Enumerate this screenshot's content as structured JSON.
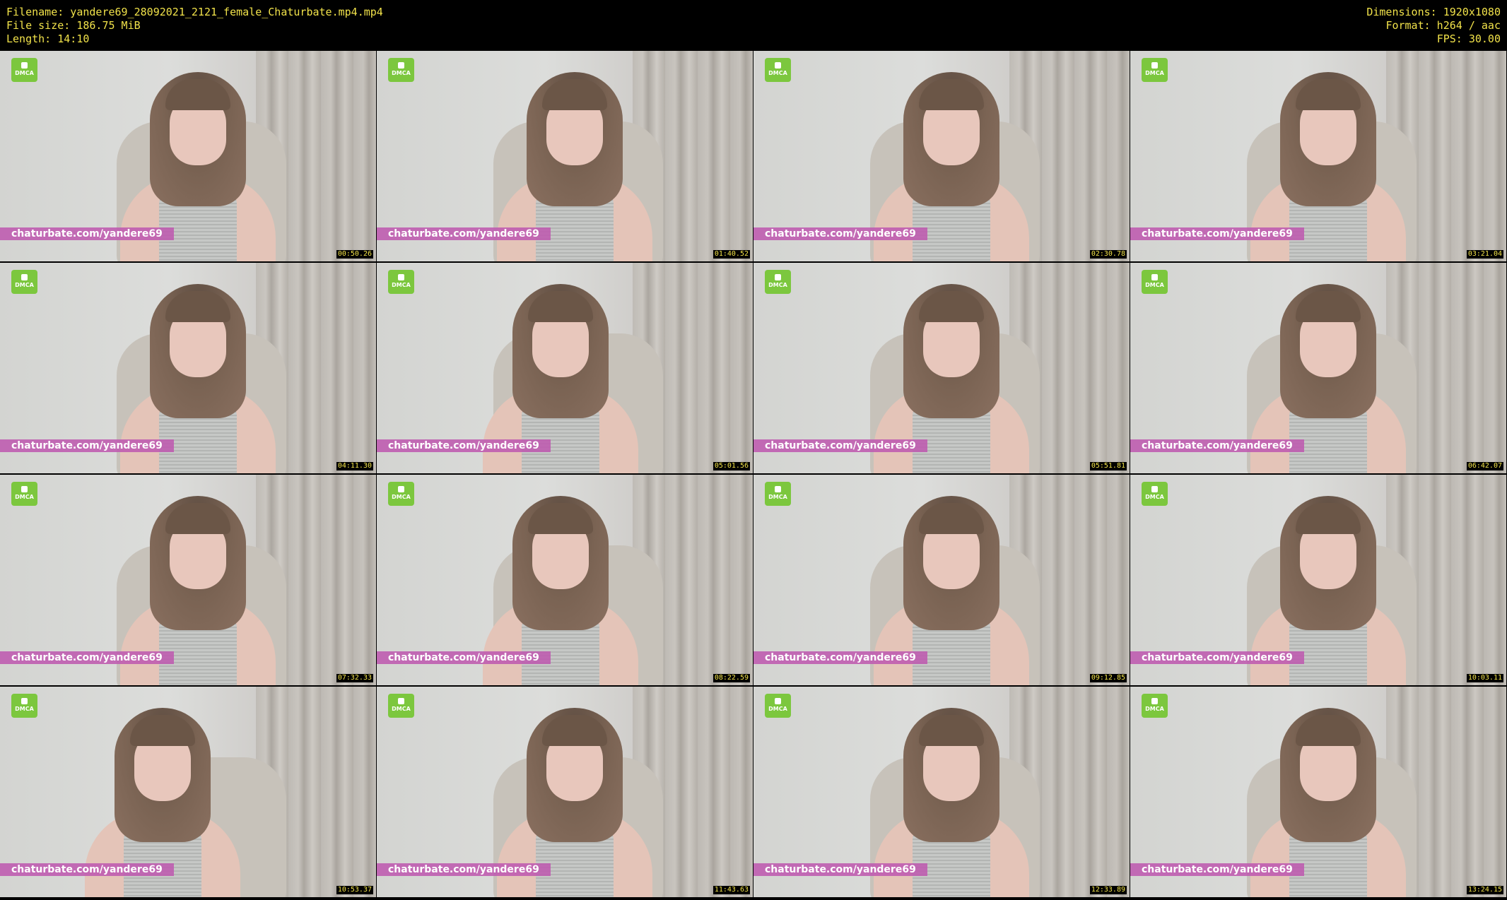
{
  "header": {
    "filename_line": "Filename: yandere69_28092021_2121_female_Chaturbate.mp4.mp4",
    "filesize_line": "File size: 186.75 MiB",
    "length_line": "Length: 14:10",
    "dimensions_line": "Dimensions: 1920x1080",
    "format_line": "Format: h264 / aac",
    "fps_line": "FPS: 30.00"
  },
  "colors": {
    "header_text": "#f1e24a",
    "watermark_bg": "#be5aaf",
    "dmca_badge": "#7cc73e"
  },
  "dmca_label": "DMCA",
  "watermark_text": "chaturbate.com/yandere69",
  "thumbnails": [
    {
      "timestamp": "00:50.26"
    },
    {
      "timestamp": "01:40.52"
    },
    {
      "timestamp": "02:30.78"
    },
    {
      "timestamp": "03:21.04"
    },
    {
      "timestamp": "04:11.30"
    },
    {
      "timestamp": "05:01.56"
    },
    {
      "timestamp": "05:51.81"
    },
    {
      "timestamp": "06:42.07"
    },
    {
      "timestamp": "07:32.33"
    },
    {
      "timestamp": "08:22.59"
    },
    {
      "timestamp": "09:12.85"
    },
    {
      "timestamp": "10:03.11"
    },
    {
      "timestamp": "10:53.37"
    },
    {
      "timestamp": "11:43.63"
    },
    {
      "timestamp": "12:33.89"
    },
    {
      "timestamp": "13:24.15"
    }
  ]
}
